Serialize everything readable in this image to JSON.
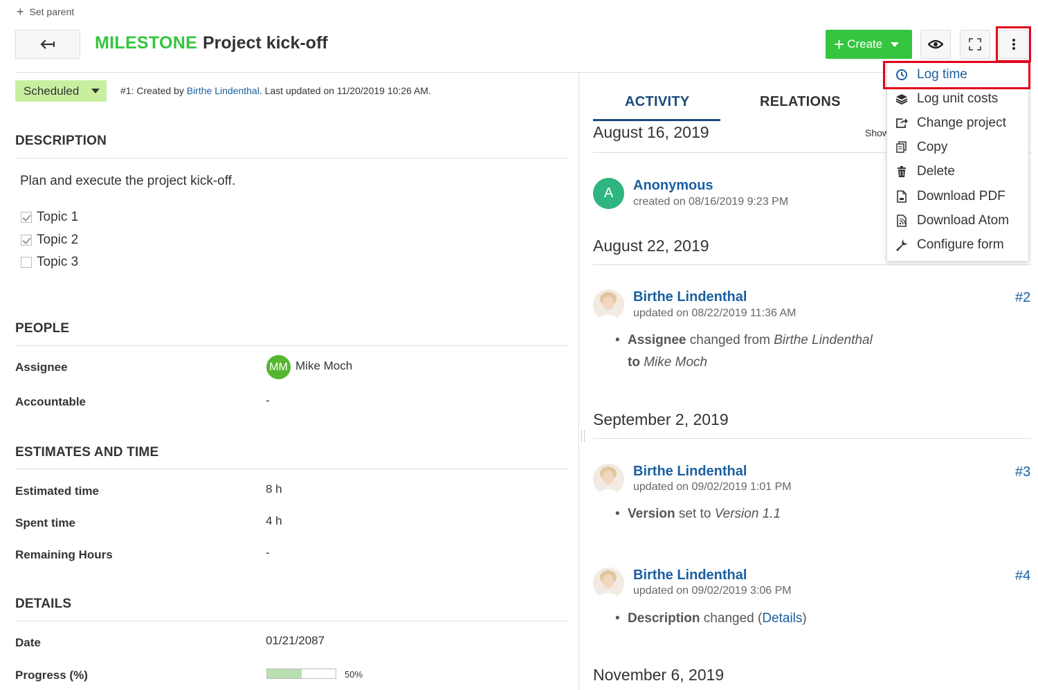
{
  "toolbar": {
    "set_parent": "Set parent",
    "type": "MILESTONE",
    "subject": "Project kick-off",
    "create_label": "Create"
  },
  "status": {
    "label": "Scheduled",
    "created_prefix": "#1: Created by ",
    "created_by": "Birthe Lindenthal",
    "updated_suffix": ". Last updated on 11/20/2019 10:26 AM."
  },
  "description": {
    "title": "DESCRIPTION",
    "text": "Plan and execute the project kick-off.",
    "topics": [
      {
        "label": "Topic 1",
        "checked": true
      },
      {
        "label": "Topic 2",
        "checked": true
      },
      {
        "label": "Topic 3",
        "checked": false
      }
    ]
  },
  "people": {
    "title": "PEOPLE",
    "assignee_label": "Assignee",
    "assignee_initials": "MM",
    "assignee_name": "Mike Moch",
    "accountable_label": "Accountable",
    "accountable_value": "-"
  },
  "estimates": {
    "title": "ESTIMATES AND TIME",
    "estimated_label": "Estimated time",
    "estimated_value": "8 h",
    "spent_label": "Spent time",
    "spent_value": "4 h",
    "remaining_label": "Remaining Hours",
    "remaining_value": "-"
  },
  "details": {
    "title": "DETAILS",
    "date_label": "Date",
    "date_value": "01/21/2087",
    "progress_label": "Progress (%)",
    "progress_text": "50%",
    "progress_value": 50
  },
  "tabs": {
    "activity": "ACTIVITY",
    "relations": "RELATIONS",
    "show_partial": "Show"
  },
  "activity": {
    "date1": "August 16, 2019",
    "entry1_initial": "A",
    "entry1_user": "Anonymous",
    "entry1_meta": "created on 08/16/2019 9:23 PM",
    "date2": "August 22, 2019",
    "entry2_user": "Birthe Lindenthal",
    "entry2_meta": "updated on 08/22/2019 11:36 AM",
    "entry2_num": "#2",
    "entry2_field": "Assignee",
    "entry2_changed": " changed from ",
    "entry2_from": "Birthe Lindenthal",
    "entry2_to_word": "to",
    "entry2_to": "Mike Moch",
    "date3": "September 2, 2019",
    "entry3_user": "Birthe Lindenthal",
    "entry3_meta": "updated on 09/02/2019 1:01 PM",
    "entry3_num": "#3",
    "entry3_field": "Version",
    "entry3_set": " set to ",
    "entry3_value": "Version 1.1",
    "entry4_user": "Birthe Lindenthal",
    "entry4_meta": "updated on 09/02/2019 3:06 PM",
    "entry4_num": "#4",
    "entry4_field": "Description",
    "entry4_changed": " changed (",
    "entry4_link": "Details",
    "entry4_close": ")",
    "date4": "November 6, 2019"
  },
  "menu": {
    "items": [
      {
        "label": "Log time",
        "icon": "clock-icon"
      },
      {
        "label": "Log unit costs",
        "icon": "layers-icon"
      },
      {
        "label": "Change project",
        "icon": "move-icon"
      },
      {
        "label": "Copy",
        "icon": "copy-icon"
      },
      {
        "label": "Delete",
        "icon": "trash-icon"
      },
      {
        "label": "Download PDF",
        "icon": "pdf-icon"
      },
      {
        "label": "Download Atom",
        "icon": "atom-icon"
      },
      {
        "label": "Configure form",
        "icon": "wrench-icon"
      }
    ]
  },
  "colors": {
    "accent_green": "#35c53f",
    "status_green": "#c7ef9f",
    "link_blue": "#1a5fa0",
    "highlight_red": "#e3001b"
  }
}
